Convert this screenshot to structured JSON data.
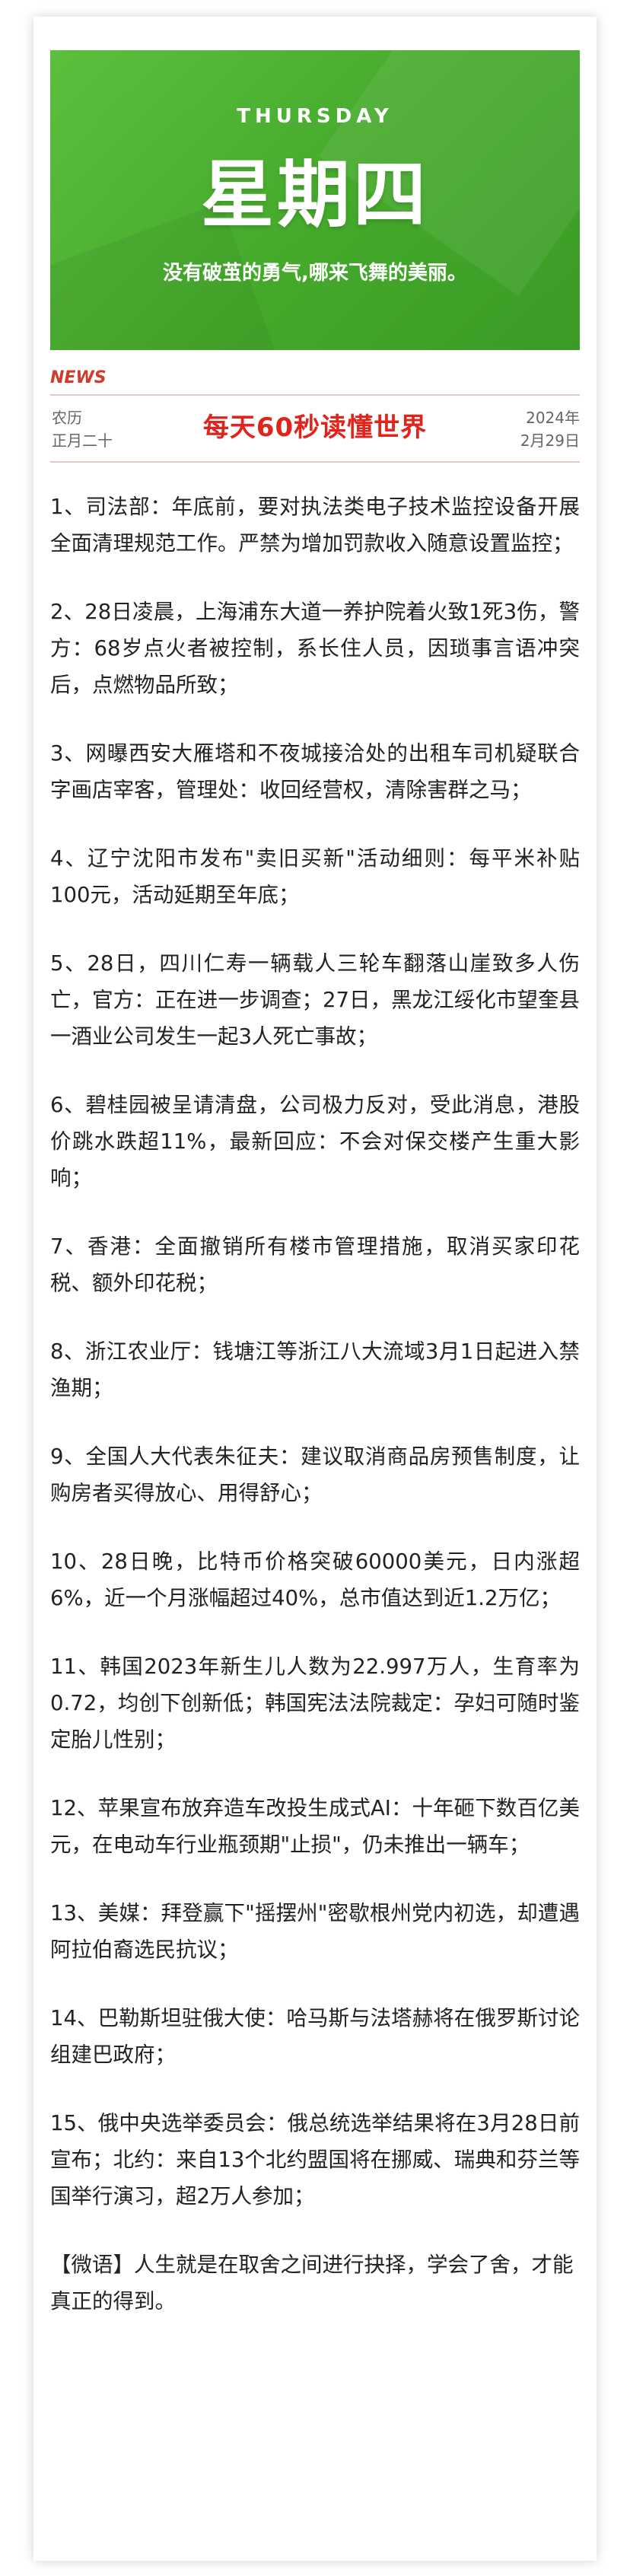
{
  "banner": {
    "weekday_en": "THURSDAY",
    "weekday_cn": "星期四",
    "slogan": "没有破茧的勇气,哪来飞舞的美丽。",
    "color": "#4caf35"
  },
  "header": {
    "news_label": "NEWS",
    "lunar_line1": "农历",
    "lunar_line2": "正月二十",
    "headline": "每天60秒读懂世界",
    "year": "2024年",
    "month_day": "2月29日",
    "headline_color": "#e0231b"
  },
  "items": [
    "1、司法部：年底前，要对执法类电子技术监控设备开展全面清理规范工作。严禁为增加罚款收入随意设置监控；",
    "2、28日凌晨，上海浦东大道一养护院着火致1死3伤，警方：68岁点火者被控制，系长住人员，因琐事言语冲突后，点燃物品所致；",
    "3、网曝西安大雁塔和不夜城接洽处的出租车司机疑联合字画店宰客，管理处：收回经营权，清除害群之马；",
    "4、辽宁沈阳市发布\"卖旧买新\"活动细则：每平米补贴100元，活动延期至年底；",
    "5、28日，四川仁寿一辆载人三轮车翻落山崖致多人伤亡，官方：正在进一步调查；27日，黑龙江绥化市望奎县一酒业公司发生一起3人死亡事故；",
    "6、碧桂园被呈请清盘，公司极力反对，受此消息，港股价跳水跌超11%，最新回应：不会对保交楼产生重大影响；",
    "7、香港：全面撤销所有楼市管理措施，取消买家印花税、额外印花税；",
    "8、浙江农业厅：钱塘江等浙江八大流域3月1日起进入禁渔期；",
    "9、全国人大代表朱征夫：建议取消商品房预售制度，让购房者买得放心、用得舒心；",
    "10、28日晚，比特币价格突破60000美元，日内涨超6%，近一个月涨幅超过40%，总市值达到近1.2万亿；",
    "11、韩国2023年新生儿人数为22.997万人，生育率为0.72，均创下创新低；韩国宪法法院裁定：孕妇可随时鉴定胎儿性别；",
    "12、苹果宣布放弃造车改投生成式AI：十年砸下数百亿美元，在电动车行业瓶颈期\"止损\"，仍未推出一辆车；",
    "13、美媒：拜登赢下\"摇摆州\"密歇根州党内初选，却遭遇阿拉伯裔选民抗议；",
    "14、巴勒斯坦驻俄大使：哈马斯与法塔赫将在俄罗斯讨论组建巴政府；",
    "15、俄中央选举委员会：俄总统选举结果将在3月28日前宣布；北约：来自13个北约盟国将在挪威、瑞典和芬兰等国举行演习，超2万人参加；"
  ],
  "quote": "【微语】人生就是在取舍之间进行抉择，学会了舍，才能真正的得到。"
}
